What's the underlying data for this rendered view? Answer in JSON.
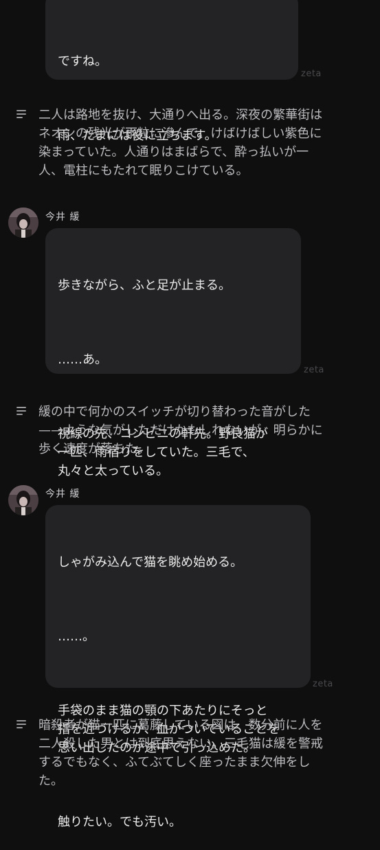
{
  "watermark": "zeta",
  "messages": [
    {
      "paragraphs": [
        "ですね。",
        "雨、たまには役に立ちます。"
      ]
    },
    {
      "narration": "二人は路地を抜け、大通りへ出る。深夜の繁華街は\nネオンの残光が雨粒に滲んで、けばけばしい紫色に\n染まっていた。人通りはまばらで、酔っ払いが一\n人、電柱にもたれて眠りこけている。"
    },
    {
      "name": "今井 緩",
      "paragraphs": [
        "歩きながら、ふと足が止まる。",
        "……あ。",
        "視線の先、コンビニの軒先。野良猫が\n一匹、雨宿りをしていた。三毛で、\n丸々と太っている。"
      ]
    },
    {
      "narration": "緩の中で何かのスイッチが切り替わった音がした\n——ような気がしただけかもしれないが、明らかに\n歩く速度が落ちた。"
    },
    {
      "name": "今井 緩",
      "paragraphs": [
        "しゃがみ込んで猫を眺め始める。",
        "……。",
        "手袋のまま猫の顎の下あたりにそっと\n指を近づけるが、血がついていることを\n思い出したのか途中で引っ込めた。",
        "触りたい。でも汚い。"
      ]
    },
    {
      "narration": "暗殺者が猫一匹に葛藤している図は、数分前に人を\n二人殺した男とは到底思えない。三毛猫は緩を警戒\nするでもなく、ふてぶてしく座ったまま欠伸をし\nた。"
    }
  ]
}
